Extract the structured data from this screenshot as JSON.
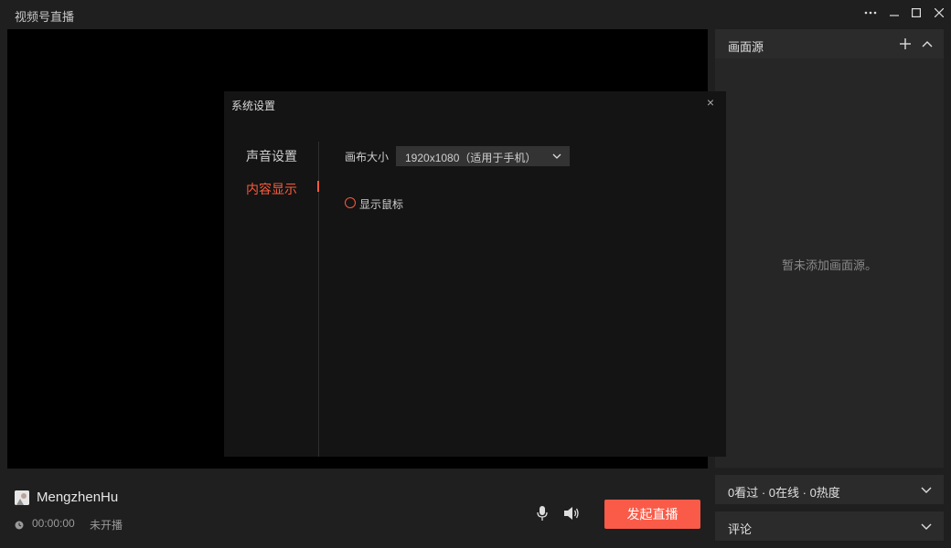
{
  "app": {
    "title": "视频号直播"
  },
  "window_controls": {
    "more": "more-icon",
    "minimize": "minimize-icon",
    "maximize": "maximize-icon",
    "close": "close-icon"
  },
  "source_panel": {
    "title": "画面源",
    "empty_text": "暂未添加画面源。"
  },
  "stats": {
    "text": "0看过 · 0在线 · 0热度"
  },
  "comments": {
    "label": "评论"
  },
  "dialog": {
    "title": "系统设置",
    "nav": [
      {
        "label": "声音设置",
        "active": false
      },
      {
        "label": "内容显示",
        "active": true
      }
    ],
    "canvas_size": {
      "label": "画布大小",
      "value": "1920x1080（适用于手机）"
    },
    "show_cursor": {
      "label": "显示鼠标",
      "checked": false
    }
  },
  "user": {
    "name": "MengzhenHu",
    "time": "00:00:00",
    "status": "未开播"
  },
  "actions": {
    "start_live": "发起直播"
  },
  "colors": {
    "accent": "#fa5b48",
    "background": "#1f1f1f",
    "panel": "#262626"
  }
}
